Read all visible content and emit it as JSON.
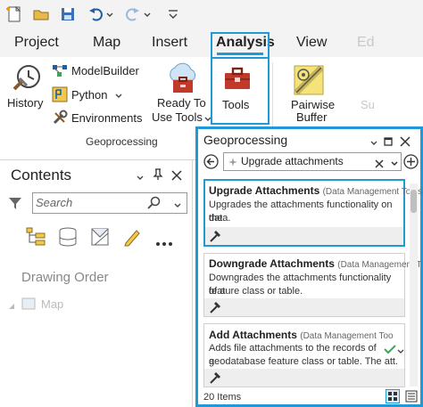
{
  "ribbon": {
    "tabs": [
      {
        "label": "Project"
      },
      {
        "label": "Map"
      },
      {
        "label": "Insert"
      },
      {
        "label": "Analysis",
        "active": true
      },
      {
        "label": "View"
      },
      {
        "label": "Ed"
      }
    ],
    "commands": {
      "history": "History",
      "modelbuilder": "ModelBuilder",
      "python": "Python",
      "environments": "Environments",
      "ready_to_use_line1": "Ready To",
      "ready_to_use_line2": "Use Tools",
      "tools": "Tools",
      "pairwise_line1": "Pairwise",
      "pairwise_line2": "Buffer",
      "faded": "Su"
    },
    "group_label": "Geoprocessing"
  },
  "contents": {
    "title": "Contents",
    "search_placeholder": "Search",
    "drawing_order": "Drawing Order",
    "map_item": "Map"
  },
  "geoprocessing": {
    "title": "Geoprocessing",
    "search_value": "Upgrade attachments",
    "items_count": "20 Items",
    "results": [
      {
        "title": "Upgrade Attachments",
        "toolbox": "(Data Management Tools)",
        "description_line1": "Upgrades the attachments functionality on the",
        "description_line2": "data.",
        "selected": true
      },
      {
        "title": "Downgrade Attachments",
        "toolbox": "(Data Management T",
        "description_line1": "Downgrades the attachments functionality of a",
        "description_line2": "feature class or table.",
        "selected": false
      },
      {
        "title": "Add Attachments",
        "toolbox": "(Data Management Too",
        "description_line1": "Adds file attachments to the records of a",
        "description_line2": "geodatabase feature class or table. The att.",
        "selected": false
      }
    ]
  },
  "colors": {
    "accent": "#1e9ad6",
    "ribbon_bg": "#f3f3f3",
    "python_yellow": "#f2c94c",
    "tools_red": "#c0392b",
    "check_green": "#3aa655"
  }
}
